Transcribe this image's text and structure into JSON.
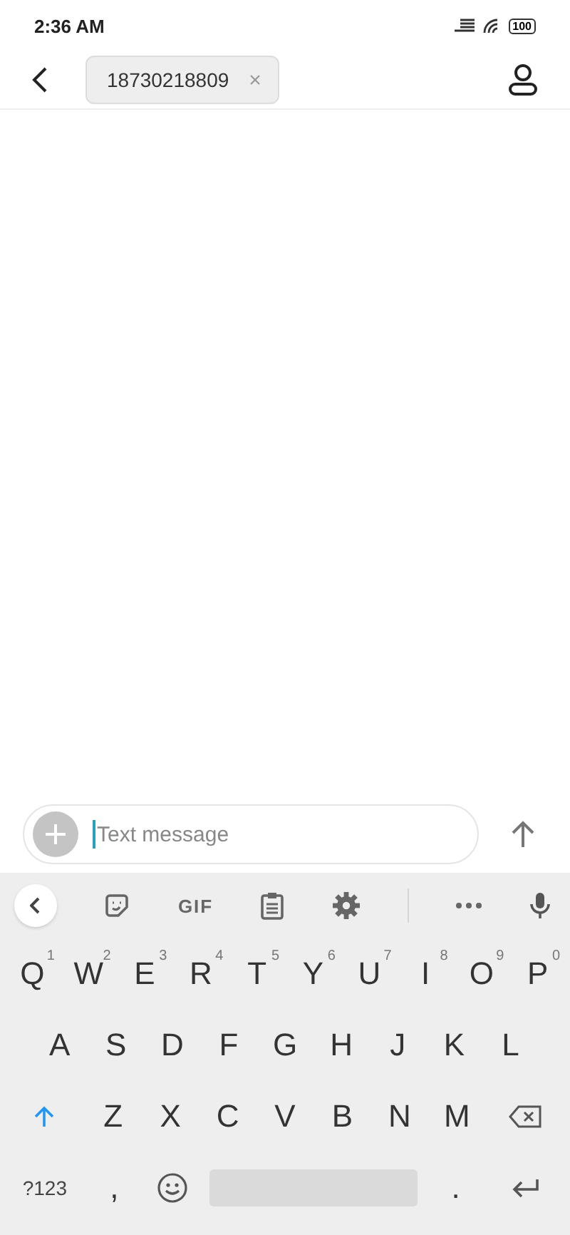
{
  "status_bar": {
    "time": "2:36 AM",
    "battery": "100"
  },
  "header": {
    "recipient": "18730218809",
    "remove": "×"
  },
  "composer": {
    "placeholder": "Text message"
  },
  "keyboard_toolbar": {
    "gif": "GIF"
  },
  "keyboard": {
    "rows": [
      {
        "keys": [
          {
            "label": "Q",
            "hint": "1"
          },
          {
            "label": "W",
            "hint": "2"
          },
          {
            "label": "E",
            "hint": "3"
          },
          {
            "label": "R",
            "hint": "4"
          },
          {
            "label": "T",
            "hint": "5"
          },
          {
            "label": "Y",
            "hint": "6"
          },
          {
            "label": "U",
            "hint": "7"
          },
          {
            "label": "I",
            "hint": "8"
          },
          {
            "label": "O",
            "hint": "9"
          },
          {
            "label": "P",
            "hint": "0"
          }
        ]
      },
      {
        "keys": [
          {
            "label": "A"
          },
          {
            "label": "S"
          },
          {
            "label": "D"
          },
          {
            "label": "F"
          },
          {
            "label": "G"
          },
          {
            "label": "H"
          },
          {
            "label": "J"
          },
          {
            "label": "K"
          },
          {
            "label": "L"
          }
        ]
      },
      {
        "keys": [
          {
            "kind": "shift"
          },
          {
            "label": "Z"
          },
          {
            "label": "X"
          },
          {
            "label": "C"
          },
          {
            "label": "V"
          },
          {
            "label": "B"
          },
          {
            "label": "N"
          },
          {
            "label": "M"
          },
          {
            "kind": "backspace"
          }
        ]
      },
      {
        "keys": [
          {
            "kind": "symbols",
            "label": "?123"
          },
          {
            "label": ","
          },
          {
            "kind": "emoji"
          },
          {
            "kind": "space"
          },
          {
            "label": "."
          },
          {
            "kind": "enter"
          }
        ]
      }
    ]
  }
}
